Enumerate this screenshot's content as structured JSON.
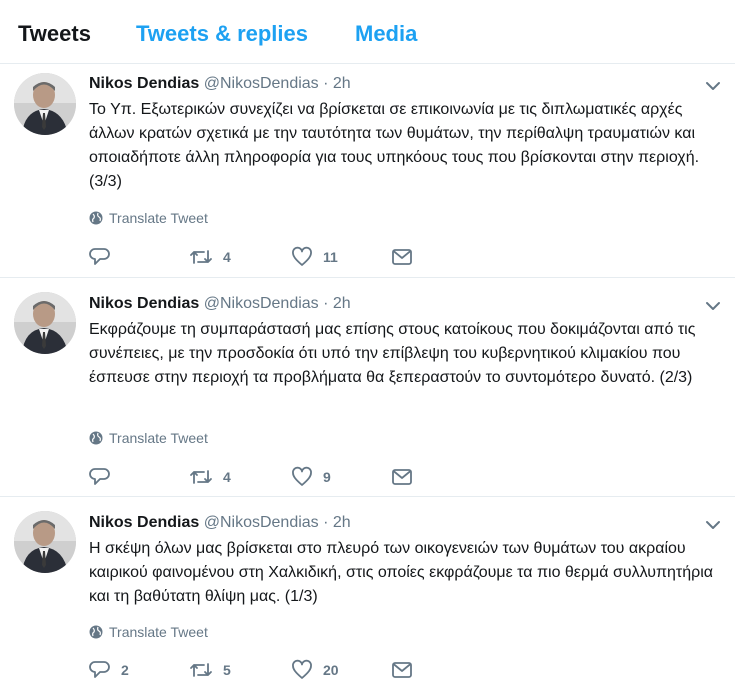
{
  "tabs": [
    "Tweets",
    "Tweets & replies",
    "Media"
  ],
  "tweets": [
    {
      "name": "Nikos Dendias",
      "handle": "@NikosDendias",
      "dot": "·",
      "time": "2h",
      "text": "Το Υπ. Εξωτερικών συνεχίζει να βρίσκεται σε επικοινωνία με τις διπλωματικές αρχές άλλων κρατών σχετικά με την ταυτότητα των θυμάτων, την περίθαλψη τραυματιών και οποιαδήποτε άλλη πληροφορία για τους υπηκόους τους που βρίσκονται στην περιοχή. (3/3)",
      "translate": "Translate Tweet",
      "replies": "",
      "retweets": "4",
      "likes": "11"
    },
    {
      "name": "Nikos Dendias",
      "handle": "@NikosDendias",
      "dot": "·",
      "time": "2h",
      "text": "Εκφράζουμε τη συμπαράστασή μας επίσης στους κατοίκους που δοκιμάζονται από τις συνέπειες, με την προσδοκία ότι υπό την επίβλεψη του κυβερνητικού κλιμακίου που έσπευσε στην περιοχή τα προβλήματα θα ξεπεραστούν το συντομότερο δυνατό. (2/3)",
      "translate": "Translate Tweet",
      "replies": "",
      "retweets": "4",
      "likes": "9"
    },
    {
      "name": "Nikos Dendias",
      "handle": "@NikosDendias",
      "dot": "·",
      "time": "2h",
      "text": "Η σκέψη όλων μας βρίσκεται στο πλευρό των οικογενειών των θυμάτων του ακραίου καιρικού φαινομένου στη Χαλκιδική, στις οποίες εκφράζουμε τα πιο θερμά συλλυπητήρια και τη βαθύτατη θλίψη μας. (1/3)",
      "translate": "Translate Tweet",
      "replies": "2",
      "retweets": "5",
      "likes": "20"
    }
  ],
  "colors": {
    "accent": "#1da1f2",
    "muted": "#657786",
    "text": "#14171a",
    "border": "#e6ecf0"
  },
  "icons": [
    "chevron-down-icon",
    "globe-icon",
    "reply-icon",
    "retweet-icon",
    "like-icon",
    "message-icon"
  ]
}
